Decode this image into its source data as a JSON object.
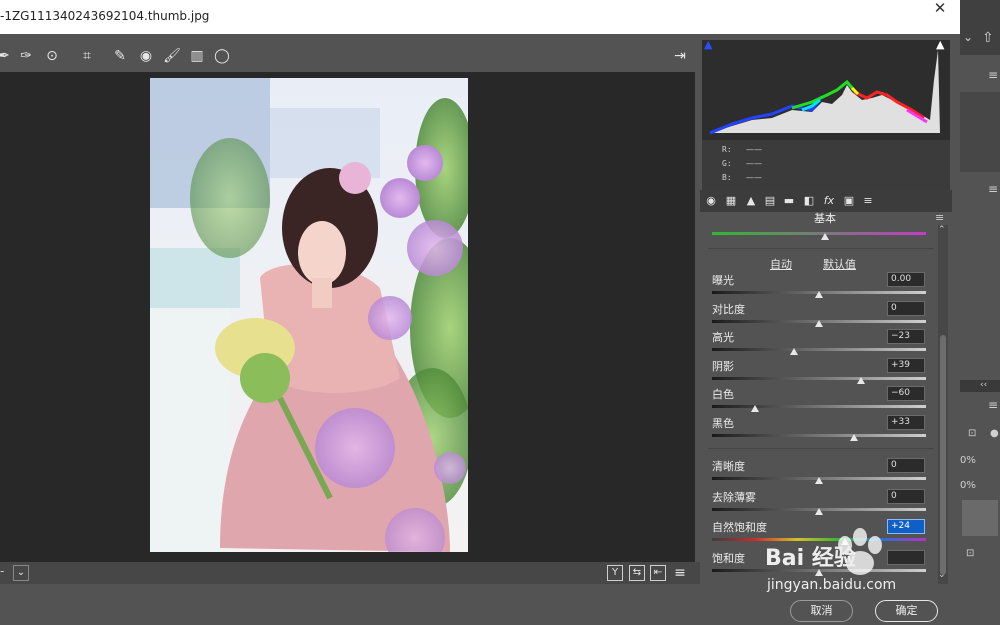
{
  "window": {
    "title": "-1ZG111340243692104.thumb.jpg",
    "close_glyph": "✕"
  },
  "toolbar": {
    "tools": [
      "eyedropper-icon",
      "color-sampler-icon",
      "target-adjust-icon",
      "crop-icon",
      "spot-removal-icon",
      "red-eye-icon",
      "brush-icon",
      "graduated-filter-icon",
      "radial-filter-icon"
    ],
    "tool_glyphs": [
      "✒",
      "✑",
      "⊙",
      "⌗",
      "✎",
      "◉",
      "🖌",
      "▥",
      "◯"
    ],
    "export_glyph": "⇥"
  },
  "histogram": {
    "clip_shadow_glyph": "▲",
    "clip_highlight_glyph": "▲"
  },
  "rgb": {
    "r_label": "R:",
    "g_label": "G:",
    "b_label": "B:",
    "r_value": "——",
    "g_value": "——",
    "b_value": "——"
  },
  "panel_tabs": [
    "basic-tab-icon",
    "tone-curve-tab-icon",
    "detail-tab-icon",
    "hsl-tab-icon",
    "split-toning-tab-icon",
    "lens-tab-icon",
    "fx-tab-icon",
    "calibration-tab-icon",
    "presets-tab-icon"
  ],
  "panel_tab_glyphs": [
    "◉",
    "▦",
    "▲",
    "▤",
    "▬",
    "◧",
    "fx",
    "▣",
    "≡"
  ],
  "basic": {
    "title": "基本",
    "menu_glyph": "≡",
    "auto_label": "自动",
    "default_label": "默认值",
    "sliders": [
      {
        "label": "曝光",
        "value": "0.00",
        "pos": 0.5
      },
      {
        "label": "对比度",
        "value": "0",
        "pos": 0.5
      },
      {
        "label": "高光",
        "value": "−23",
        "pos": 0.385
      },
      {
        "label": "阴影",
        "value": "+39",
        "pos": 0.695
      },
      {
        "label": "白色",
        "value": "−60",
        "pos": 0.2
      },
      {
        "label": "黑色",
        "value": "+33",
        "pos": 0.665
      }
    ],
    "sliders2": [
      {
        "label": "清晰度",
        "value": "0",
        "pos": 0.5
      },
      {
        "label": "去除薄雾",
        "value": "0",
        "pos": 0.5
      },
      {
        "label": "自然饱和度",
        "value": "+24",
        "pos": 0.62,
        "selected": true
      },
      {
        "label": "饱和度",
        "value": "",
        "pos": 0.5
      }
    ]
  },
  "bottom_bar": {
    "left_glyph": "-",
    "dropdown_glyph": "⌄",
    "view_y": "Y",
    "swap": "⇆",
    "copy": "⇤",
    "settings": "≡"
  },
  "footer": {
    "cancel": "取消",
    "ok": "确定"
  },
  "watermark": {
    "brand": "Bai 经验",
    "url": "jingyan.baidu.com"
  },
  "ps_strip": {
    "share_glyph": "⇧",
    "chev1": "⌄",
    "lock_glyph": "🔒",
    "pct1": "0%",
    "pct2": "0%",
    "menu": "≡",
    "collapse": "‹‹"
  }
}
